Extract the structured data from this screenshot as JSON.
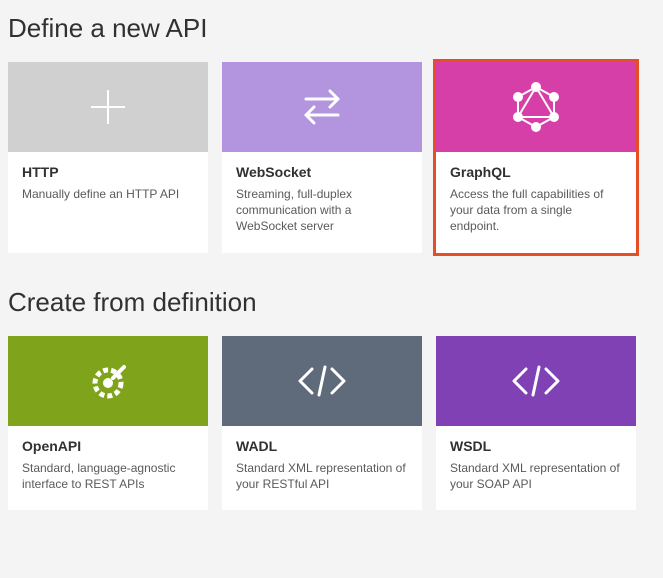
{
  "sections": {
    "define": {
      "heading": "Define a new API",
      "cards": {
        "http": {
          "title": "HTTP",
          "desc": "Manually define an HTTP API"
        },
        "websocket": {
          "title": "WebSocket",
          "desc": "Streaming, full-duplex communication with a WebSocket server"
        },
        "graphql": {
          "title": "GraphQL",
          "desc": "Access the full capabilities of your data from a single endpoint."
        }
      }
    },
    "create": {
      "heading": "Create from definition",
      "cards": {
        "openapi": {
          "title": "OpenAPI",
          "desc": "Standard, language-agnostic interface to REST APIs"
        },
        "wadl": {
          "title": "WADL",
          "desc": "Standard XML representation of your RESTful API"
        },
        "wsdl": {
          "title": "WSDL",
          "desc": "Standard XML representation of your SOAP API"
        }
      }
    }
  },
  "selected_card": "graphql",
  "colors": {
    "grey": "#d0d0d0",
    "lilac": "#b295de",
    "pink": "#d63fa8",
    "olive": "#7fa41b",
    "slate": "#5f6b7a",
    "purple": "#8041b4",
    "highlight": "#e74d27"
  }
}
